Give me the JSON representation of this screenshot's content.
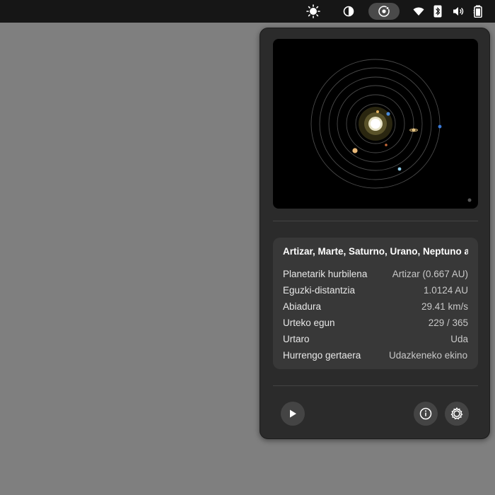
{
  "topbar": {
    "icons": [
      "brightness-icon",
      "night-light-icon",
      "solar-system-applet-icon",
      "wifi-icon",
      "bluetooth-icon",
      "volume-icon",
      "battery-icon"
    ]
  },
  "colors": {
    "desktop": "#7f7f7f",
    "topbar": "#161616",
    "panel": "#2b2b2b",
    "card": "#383838",
    "button": "#444444"
  },
  "info": {
    "title": "Artizar, Marte, Saturno, Urano, Neptuno a",
    "rows": [
      {
        "label": "Planetarik hurbilena",
        "value": "Artizar (0.667 AU)"
      },
      {
        "label": "Eguzki-distantzia",
        "value": "1.0124 AU"
      },
      {
        "label": "Abiadura",
        "value": "29.41 km/s"
      },
      {
        "label": "Urteko egun",
        "value": "229 / 365"
      },
      {
        "label": "Urtaro",
        "value": "Uda"
      },
      {
        "label": "Hurrengo gertaera",
        "value": "Udazkeneko ekinokzioa"
      }
    ]
  },
  "controls": {
    "play_icon": "play-icon",
    "info_icon": "info-icon",
    "settings_icon": "settings-icon"
  }
}
